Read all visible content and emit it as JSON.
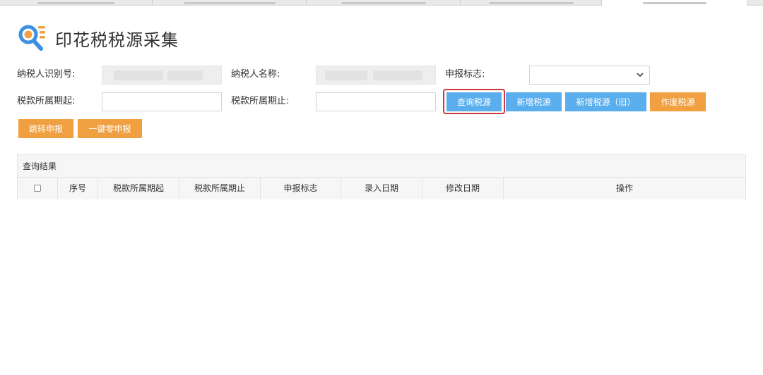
{
  "page_title": "印花税税源采集",
  "filters": {
    "taxpayer_id_label": "纳税人识别号:",
    "taxpayer_name_label": "纳税人名称:",
    "declare_flag_label": "申报标志:",
    "period_start_label": "税款所属期起:",
    "period_end_label": "税款所属期止:",
    "declare_flag_value": ""
  },
  "buttons": {
    "query": "查询税源",
    "add": "新增税源",
    "add_old": "新增税源（旧）",
    "void": "作废税源",
    "jump": "跳转申报",
    "zero": "一键零申报"
  },
  "results": {
    "title": "查询结果",
    "columns": [
      "序号",
      "税款所属期起",
      "税款所属期止",
      "申报标志",
      "录入日期",
      "修改日期",
      "操作"
    ]
  },
  "colors": {
    "blue_button": "#5aaeee",
    "orange_button": "#f0a040",
    "highlight": "#d0393b"
  }
}
